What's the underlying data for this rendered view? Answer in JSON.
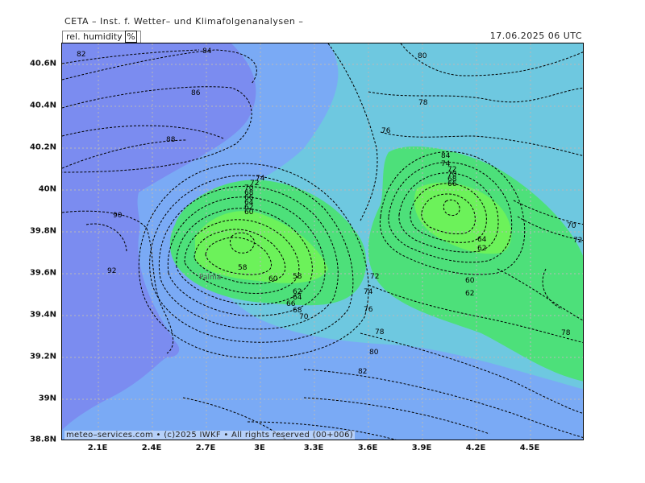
{
  "header": {
    "title": "CETA – Inst. f. Wetter– und Klimafolgenanalysen –",
    "parameter": "rel. humidity",
    "unit": "%",
    "valid_time": "17.06.2025 06 UTC"
  },
  "footer": {
    "credit": "meteo–services.com • (c)2025 IWKF • All rights reserved (00+006)"
  },
  "map": {
    "lat_labels": [
      "40.6N",
      "40.4N",
      "40.2N",
      "40N",
      "39.8N",
      "39.6N",
      "39.4N",
      "39.2N",
      "39N",
      "38.8N"
    ],
    "lon_labels": [
      "2.1E",
      "2.4E",
      "2.7E",
      "3E",
      "3.3E",
      "3.6E",
      "3.9E",
      "4.2E",
      "4.5E"
    ],
    "place_label": "Palma",
    "colors": {
      "lightblue": "#6ec8e0",
      "blue": "#7aaaf5",
      "violet": "#7b8cf0",
      "green": "#4de07a",
      "brightgreen": "#6cf25a"
    },
    "contour_labels": [
      "82",
      "84",
      "86",
      "88",
      "90",
      "92",
      "80",
      "78",
      "76",
      "74",
      "72",
      "70",
      "68",
      "66",
      "64",
      "62",
      "60",
      "58",
      "58",
      "60",
      "62",
      "64",
      "66",
      "68",
      "70",
      "72",
      "74",
      "76",
      "78",
      "80",
      "82",
      "84",
      "74",
      "72",
      "70",
      "68",
      "66",
      "64",
      "62",
      "60",
      "62",
      "70",
      "72",
      "78",
      "76",
      "68"
    ]
  }
}
